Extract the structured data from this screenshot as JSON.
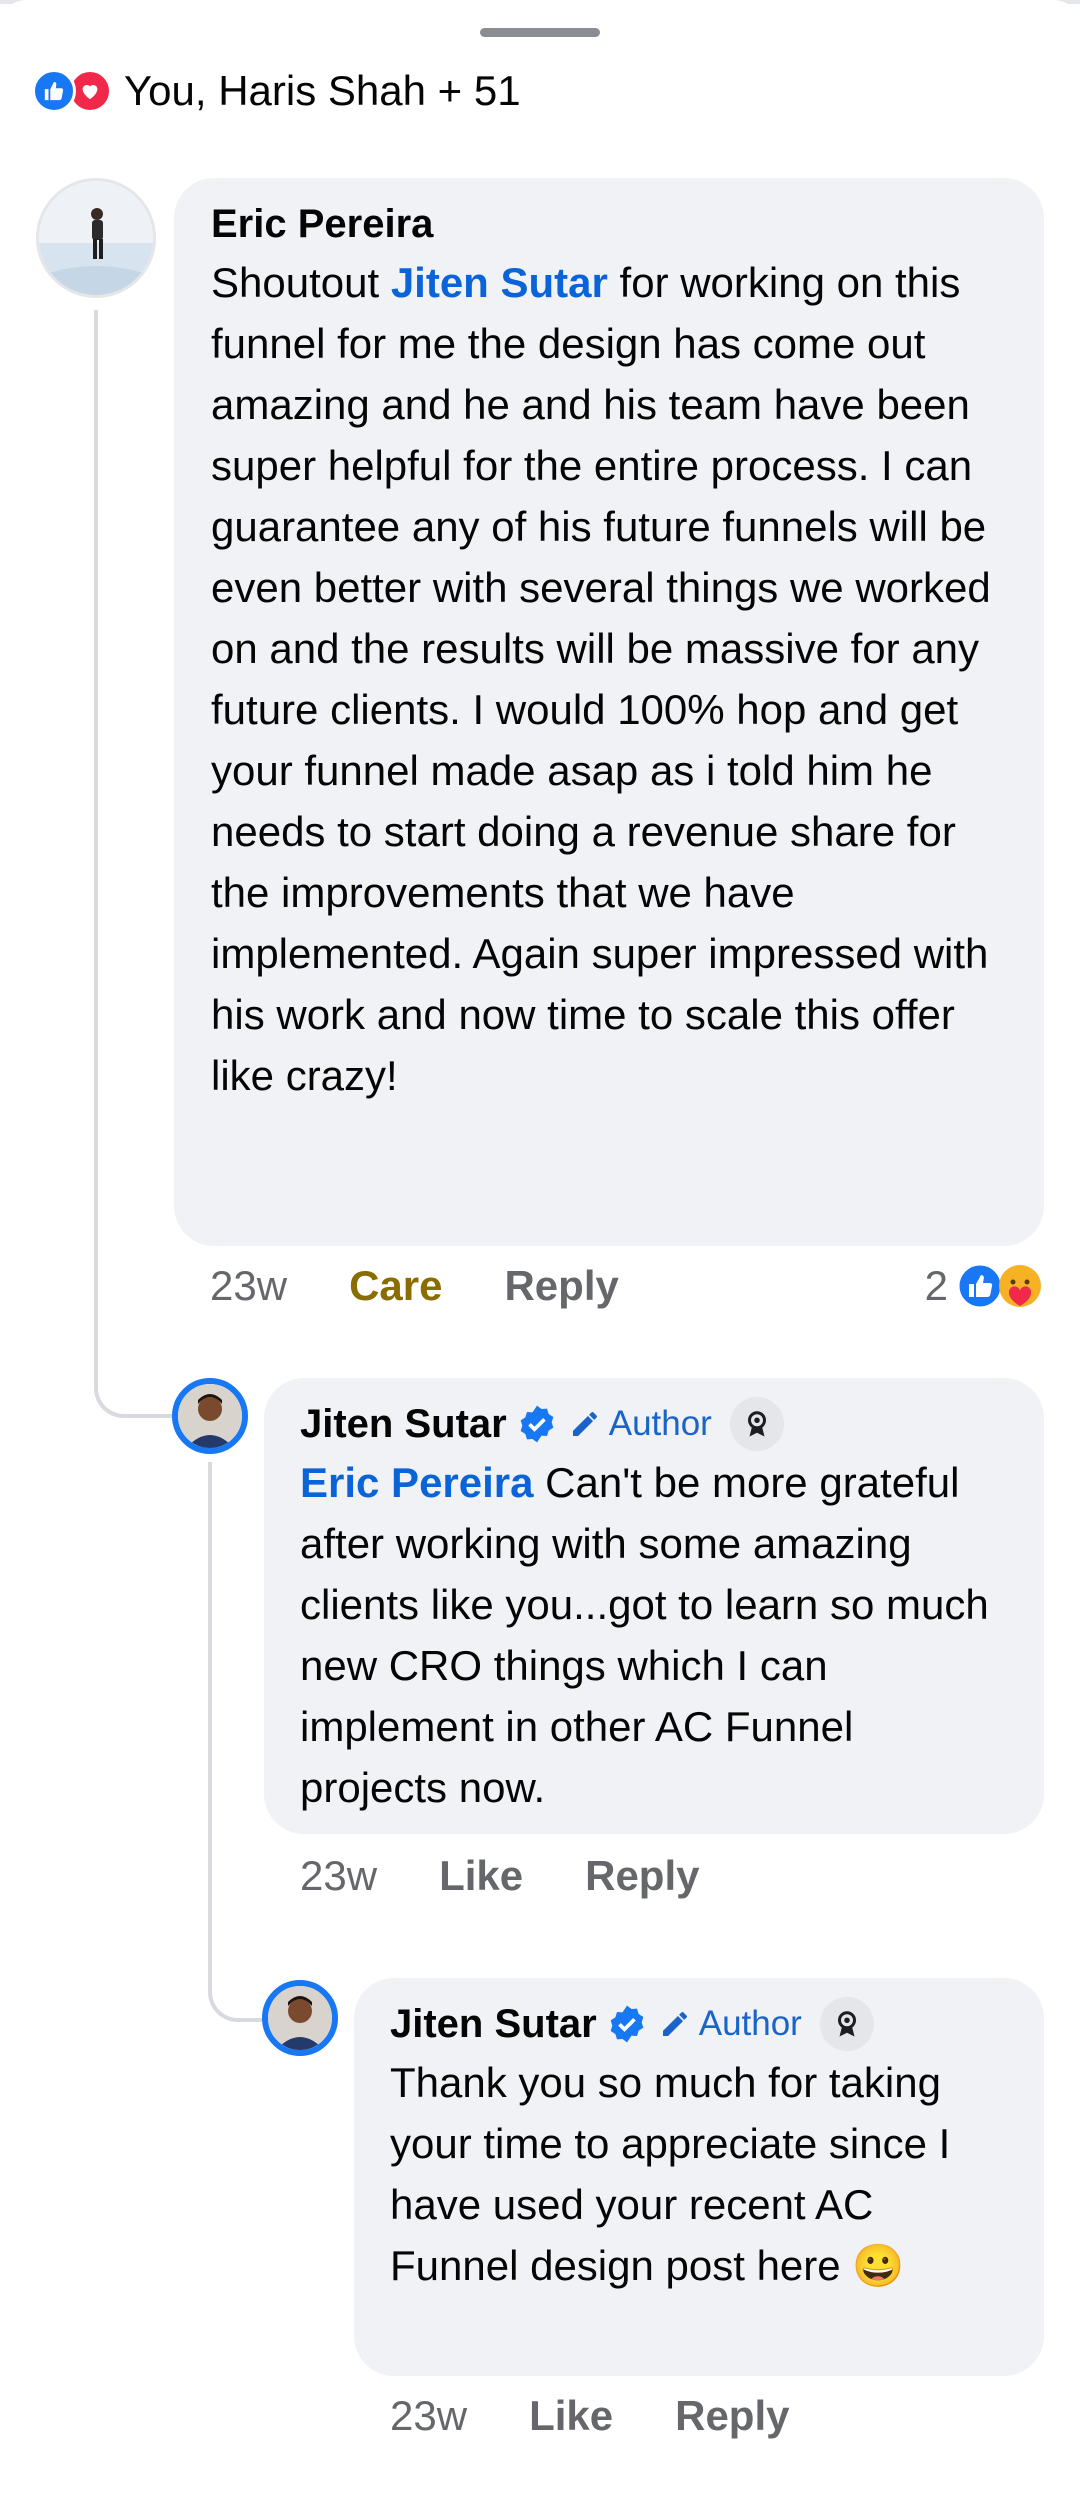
{
  "reactions_summary": {
    "text": "You, Haris Shah + 51",
    "icons": [
      "like-icon",
      "love-icon"
    ]
  },
  "comments": [
    {
      "author": "Eric Pereira",
      "text_before_mention": "Shoutout ",
      "mention": "Jiten Sutar",
      "text_after_mention": " for working on this funnel for me the design has come out amazing and he and his team have been super helpful for the entire process. I can guarantee any of his future funnels will be even better with several things we worked on and the results will be massive for any future clients. I would 100% hop and get your funnel made asap as i told him he needs to start doing a revenue share for the improvements that we have implemented. Again super impressed with his work and now time to scale this offer like crazy!",
      "time": "23w",
      "reaction_action": "Care",
      "reply_label": "Reply",
      "reaction_count": "2",
      "reaction_icons": [
        "like-icon",
        "care-icon"
      ]
    },
    {
      "author": "Jiten Sutar",
      "badge": "Author",
      "mention": "Eric Pereira",
      "text_after_mention": " Can't be more grateful after working with some amazing clients like you...got to learn so much new CRO things which I can implement in other AC Funnel projects now.",
      "time": "23w",
      "like_label": "Like",
      "reply_label": "Reply"
    },
    {
      "author": "Jiten Sutar",
      "badge": "Author",
      "text": "Thank you so much for taking your time to appreciate since I have used your recent AC Funnel design post here",
      "emoji": "😀",
      "time": "23w",
      "like_label": "Like",
      "reply_label": "Reply"
    }
  ],
  "colors": {
    "accent_blue": "#1877f2",
    "mention_blue": "#0a64d8",
    "bubble_bg": "#f0f2f5",
    "care_gold": "#8a6d00",
    "meta_gray": "#65676b"
  }
}
